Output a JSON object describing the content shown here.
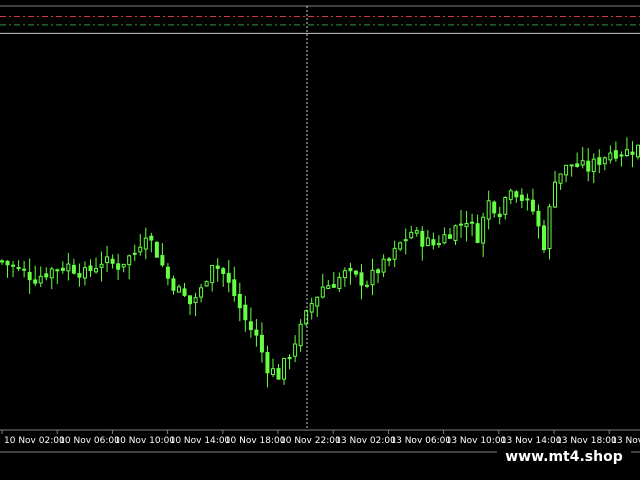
{
  "chart_data": {
    "type": "candlestick",
    "background": "#000000",
    "candle_color": "#66ff44",
    "ylim": [
      0,
      100
    ],
    "x_ticks": [
      "10 Nov 02:00",
      "10 Nov 06:00",
      "10 Nov 10:00",
      "10 Nov 14:00",
      "10 Nov 18:00",
      "10 Nov 22:00",
      "13 Nov 02:00",
      "13 Nov 06:00",
      "13 Nov 10:00",
      "13 Nov 14:00",
      "13 Nov 18:00",
      "13 Nov"
    ],
    "close_profile": [
      [
        0,
        40
      ],
      [
        3,
        38
      ],
      [
        6,
        36
      ],
      [
        9,
        38
      ],
      [
        12,
        39
      ],
      [
        15,
        37
      ],
      [
        18,
        40
      ],
      [
        21,
        39
      ],
      [
        24,
        42
      ],
      [
        26,
        47
      ],
      [
        28,
        42
      ],
      [
        30,
        36
      ],
      [
        32,
        33
      ],
      [
        34,
        30
      ],
      [
        36,
        33
      ],
      [
        38,
        40
      ],
      [
        40,
        37
      ],
      [
        42,
        32
      ],
      [
        44,
        26
      ],
      [
        46,
        22
      ],
      [
        48,
        15
      ],
      [
        50,
        13
      ],
      [
        52,
        18
      ],
      [
        54,
        24
      ],
      [
        56,
        30
      ],
      [
        58,
        34
      ],
      [
        60,
        35
      ],
      [
        62,
        37
      ],
      [
        64,
        36
      ],
      [
        66,
        35
      ],
      [
        68,
        38
      ],
      [
        70,
        40
      ],
      [
        72,
        44
      ],
      [
        74,
        47
      ],
      [
        76,
        45
      ],
      [
        78,
        44
      ],
      [
        80,
        46
      ],
      [
        82,
        48
      ],
      [
        84,
        50
      ],
      [
        86,
        46
      ],
      [
        88,
        54
      ],
      [
        90,
        52
      ],
      [
        92,
        58
      ],
      [
        94,
        55
      ],
      [
        96,
        52
      ],
      [
        98,
        44
      ],
      [
        100,
        60
      ],
      [
        103,
        63
      ],
      [
        106,
        62
      ],
      [
        110,
        66
      ],
      [
        113,
        66
      ],
      [
        115,
        67
      ]
    ],
    "reference_lines": [
      {
        "y": 98,
        "color": "#d03a3a",
        "style": "dashdot"
      },
      {
        "y": 96,
        "color": "#2a9a3a",
        "style": "dashdot"
      },
      {
        "y": 94,
        "color": "#c8c8c8",
        "style": "solid"
      }
    ],
    "crosshair": {
      "color": "#d0d0d0"
    }
  },
  "watermark": "www.mt4.shop"
}
